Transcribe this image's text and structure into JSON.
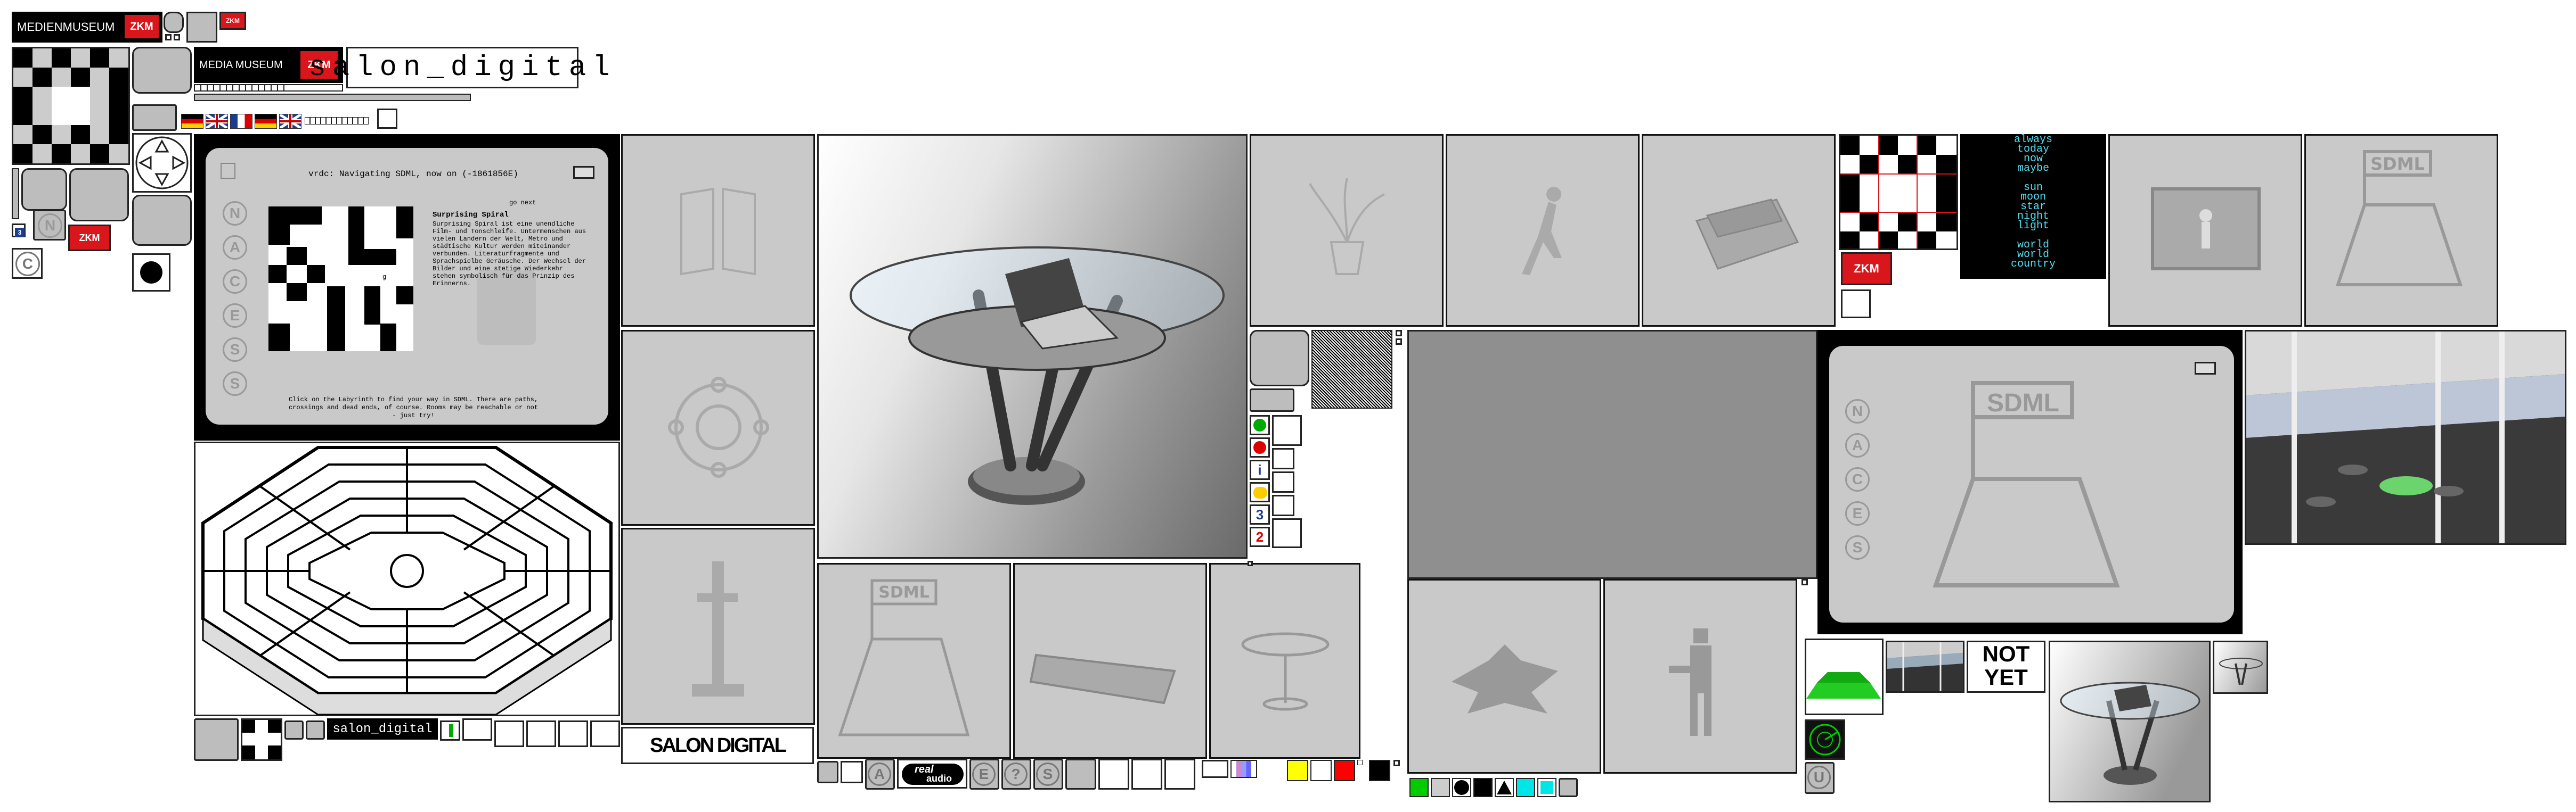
{
  "branding": {
    "medienmuseum_label": "MEDIENMUSEUM",
    "media_museum_label": "MEDIA MUSEUM",
    "zkm_label": "ZKM",
    "salon_title": "salon_digital",
    "salon_small": "salon_digital",
    "salon_mirror_text": "SALON DIGITAL"
  },
  "vrml_panel": {
    "header": "vrdc: Navigating SDML, now on (-1861856E)",
    "go_next": "go next",
    "heading": "Surprising Spiral",
    "body": "Surprising Spiral ist eine unendliche Film- und Tonschleife. Untermenschen aus vielen Landern der Welt, Metro und städtische Kultur werden miteinander verbunden. Literaturfragmente und Sprachspielbe Geräusche. Der Wechsel der Bilder und eine stetige Wiederkehr stehen symbolisch für das Prinzip des Erinnerns.",
    "footer": "Click on the Labyrinth to find your way in SDML. There are paths, crossings and dead ends, of course. Rooms may be reachable or not - just try!",
    "nacess_letters": [
      "N",
      "A",
      "C",
      "E",
      "S",
      "S"
    ]
  },
  "poem": {
    "lines": [
      "always",
      "today",
      "now",
      "maybe",
      "",
      "sun",
      "moon",
      "star",
      "night",
      "light",
      "",
      "world",
      "world",
      "country"
    ]
  },
  "not_yet": {
    "line1": "NOT",
    "line2": "YET"
  },
  "sdml_label": "SDML",
  "real_audio": {
    "top": "real",
    "bottom": "audio"
  },
  "side_numbers": [
    "3",
    "2"
  ],
  "icons": {
    "home": "house-icon",
    "navigator": "direction-pad-icon",
    "record": "black-dot-icon"
  },
  "colors": {
    "zkm_red": "#d9161c",
    "panel_grey": "#c9c9c9",
    "cyan_text": "#55e0f0",
    "green_floor": "#22cc22"
  },
  "palette": [
    "#ffff00",
    "#ffffff",
    "#ff0000",
    "#ffffff",
    "#000000"
  ],
  "shape_row": [
    "#00cc00",
    "#cccccc",
    "#000000",
    "#000000",
    "#000000",
    "#00e5e5",
    "#00e5e5",
    "#cccccc"
  ]
}
